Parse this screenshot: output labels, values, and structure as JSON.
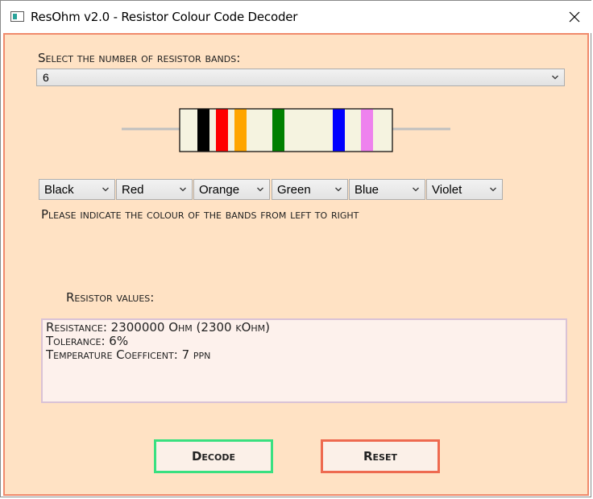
{
  "window": {
    "title": "ResOhm v2.0 - Resistor Colour Code Decoder"
  },
  "band_count": {
    "label": "Select the number of resistor bands:",
    "value": "6"
  },
  "resistor": {
    "body_color": "#f5f3e0",
    "lead_color": "#c0c0c0",
    "bands": [
      {
        "color_name": "Black",
        "hex": "#000000"
      },
      {
        "color_name": "Red",
        "hex": "#ff0000"
      },
      {
        "color_name": "Orange",
        "hex": "#ffa500"
      },
      {
        "color_name": "Green",
        "hex": "#008000"
      },
      {
        "color_name": "Blue",
        "hex": "#0000ff"
      },
      {
        "color_name": "Violet",
        "hex": "#ee82ee"
      }
    ]
  },
  "band_selects": [
    "Black",
    "Red",
    "Orange",
    "Green",
    "Blue",
    "Violet"
  ],
  "instructions": "Please indicate the colour of the bands from left to right",
  "results": {
    "label": "Resistor values:",
    "lines": [
      "Resistance: 2300000 Ohm (2300 kOhm)",
      "Tolerance: 6%",
      "Temperature Coefficent: 7 ppn"
    ]
  },
  "buttons": {
    "decode": "Decode",
    "reset": "Reset"
  },
  "colors": {
    "client_bg": "#ffe2c4",
    "client_border": "#f08a6c",
    "decode_border": "#39e080",
    "reset_border": "#ee6a50"
  }
}
